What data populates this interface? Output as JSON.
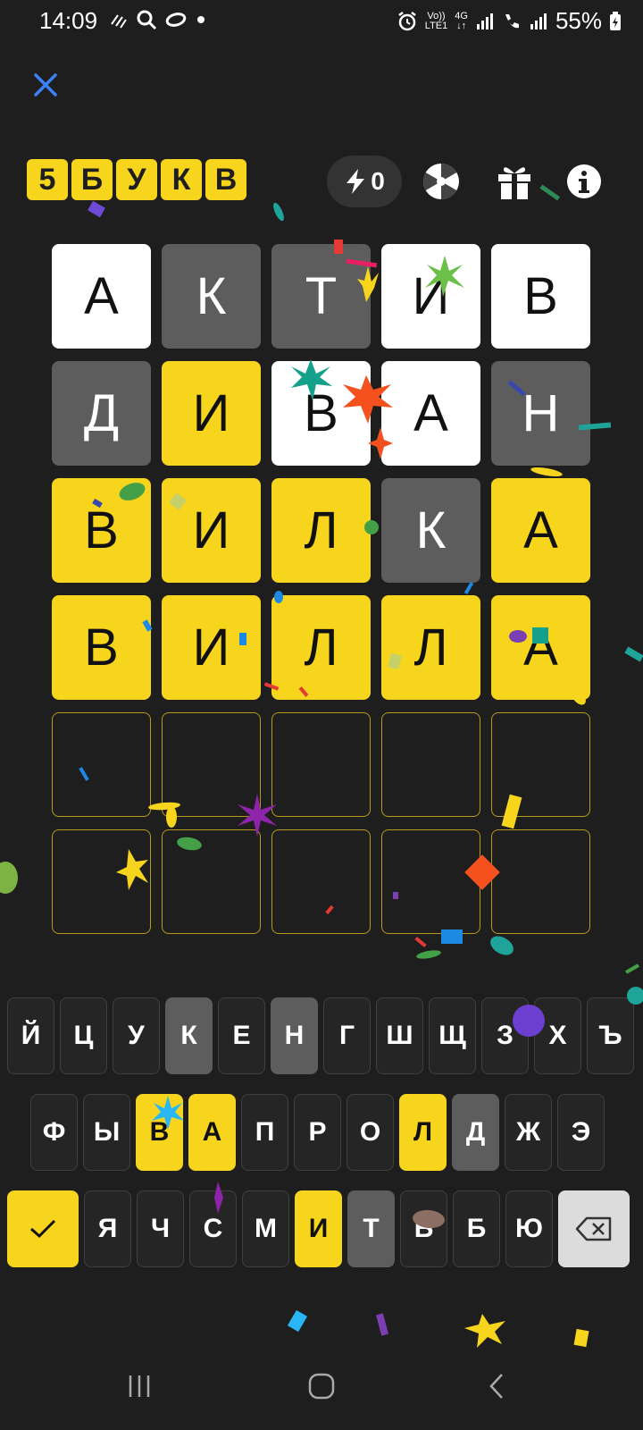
{
  "status": {
    "time": "14:09",
    "volte_top": "Vo))",
    "volte_bottom": "LTE1",
    "net_type": "4G",
    "battery": "55%"
  },
  "logo": {
    "letters": [
      "5",
      "Б",
      "У",
      "К",
      "В"
    ]
  },
  "streak": {
    "count": "0"
  },
  "board": {
    "rows": [
      [
        {
          "l": "А",
          "s": "white"
        },
        {
          "l": "К",
          "s": "gray"
        },
        {
          "l": "Т",
          "s": "gray"
        },
        {
          "l": "И",
          "s": "white"
        },
        {
          "l": "В",
          "s": "white"
        }
      ],
      [
        {
          "l": "Д",
          "s": "gray"
        },
        {
          "l": "И",
          "s": "yellow"
        },
        {
          "l": "В",
          "s": "white"
        },
        {
          "l": "А",
          "s": "white"
        },
        {
          "l": "Н",
          "s": "gray"
        }
      ],
      [
        {
          "l": "В",
          "s": "yellow"
        },
        {
          "l": "И",
          "s": "yellow"
        },
        {
          "l": "Л",
          "s": "yellow"
        },
        {
          "l": "К",
          "s": "gray"
        },
        {
          "l": "А",
          "s": "yellow"
        }
      ],
      [
        {
          "l": "В",
          "s": "yellow"
        },
        {
          "l": "И",
          "s": "yellow"
        },
        {
          "l": "Л",
          "s": "yellow"
        },
        {
          "l": "Л",
          "s": "yellow"
        },
        {
          "l": "А",
          "s": "yellow"
        }
      ],
      [
        {
          "l": "",
          "s": "empty"
        },
        {
          "l": "",
          "s": "empty"
        },
        {
          "l": "",
          "s": "empty"
        },
        {
          "l": "",
          "s": "empty"
        },
        {
          "l": "",
          "s": "empty"
        }
      ],
      [
        {
          "l": "",
          "s": "empty"
        },
        {
          "l": "",
          "s": "empty"
        },
        {
          "l": "",
          "s": "empty"
        },
        {
          "l": "",
          "s": "empty"
        },
        {
          "l": "",
          "s": "empty"
        }
      ]
    ]
  },
  "keyboard": {
    "row1": [
      {
        "k": "Й",
        "s": ""
      },
      {
        "k": "Ц",
        "s": ""
      },
      {
        "k": "У",
        "s": ""
      },
      {
        "k": "К",
        "s": "gray"
      },
      {
        "k": "Е",
        "s": ""
      },
      {
        "k": "Н",
        "s": "gray"
      },
      {
        "k": "Г",
        "s": ""
      },
      {
        "k": "Ш",
        "s": ""
      },
      {
        "k": "Щ",
        "s": ""
      },
      {
        "k": "З",
        "s": ""
      },
      {
        "k": "Х",
        "s": ""
      },
      {
        "k": "Ъ",
        "s": ""
      }
    ],
    "row2": [
      {
        "k": "Ф",
        "s": ""
      },
      {
        "k": "Ы",
        "s": ""
      },
      {
        "k": "В",
        "s": "yellow"
      },
      {
        "k": "А",
        "s": "yellow"
      },
      {
        "k": "П",
        "s": ""
      },
      {
        "k": "Р",
        "s": ""
      },
      {
        "k": "О",
        "s": ""
      },
      {
        "k": "Л",
        "s": "yellow"
      },
      {
        "k": "Д",
        "s": "gray"
      },
      {
        "k": "Ж",
        "s": ""
      },
      {
        "k": "Э",
        "s": ""
      }
    ],
    "row3": [
      {
        "k": "Я",
        "s": ""
      },
      {
        "k": "Ч",
        "s": ""
      },
      {
        "k": "С",
        "s": ""
      },
      {
        "k": "М",
        "s": ""
      },
      {
        "k": "И",
        "s": "yellow"
      },
      {
        "k": "Т",
        "s": "gray"
      },
      {
        "k": "Ь",
        "s": ""
      },
      {
        "k": "Б",
        "s": ""
      },
      {
        "k": "Ю",
        "s": ""
      }
    ]
  },
  "colors": {
    "background": "#1e1e1e",
    "correct": "#f7d51d",
    "absent": "#5d5d5d",
    "present": "#ffffff",
    "accent_close": "#3b82f6"
  }
}
